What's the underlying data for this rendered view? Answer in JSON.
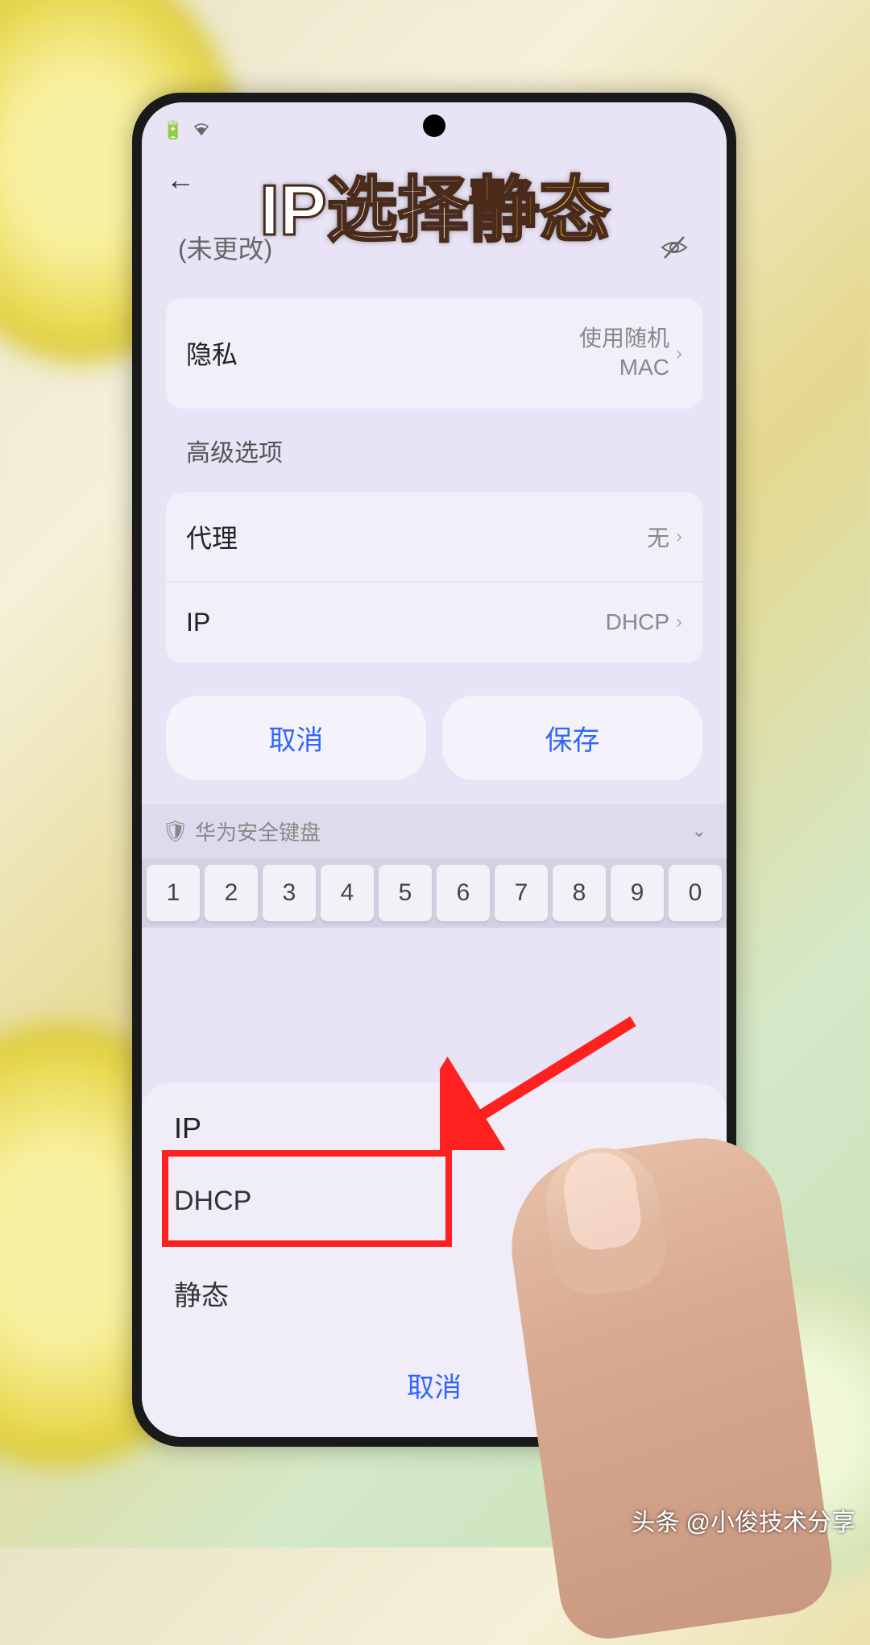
{
  "overlay": {
    "text1": "IP选择",
    "text2": "静态"
  },
  "status": {
    "battery_icon": "B",
    "wifi_icon": "wifi"
  },
  "password": {
    "label": "(未更改)"
  },
  "settings": {
    "privacy": {
      "label": "隐私",
      "value": "使用随机\nMAC"
    },
    "advanced": {
      "label": "高级选项"
    },
    "proxy": {
      "label": "代理",
      "value": "无"
    },
    "ip": {
      "label": "IP",
      "value": "DHCP"
    }
  },
  "buttons": {
    "cancel": "取消",
    "save": "保存"
  },
  "keyboard": {
    "header": "华为安全键盘",
    "keys": [
      "1",
      "2",
      "3",
      "4",
      "5",
      "6",
      "7",
      "8",
      "9",
      "0"
    ]
  },
  "sheet": {
    "title": "IP",
    "option1": "DHCP",
    "option2": "静态",
    "cancel": "取消"
  },
  "watermark": {
    "prefix": "头条",
    "author": "@小俊技术分享"
  }
}
